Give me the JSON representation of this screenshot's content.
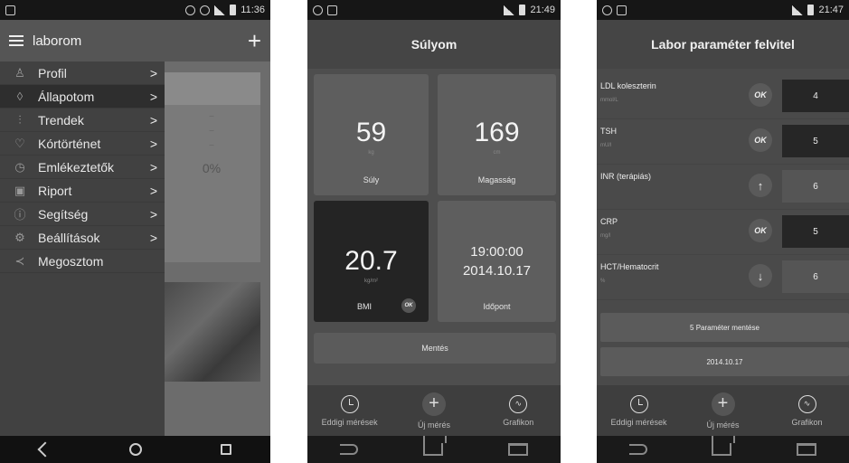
{
  "phone1": {
    "status": {
      "time": "11:36"
    },
    "appbar": {
      "title": "laborom",
      "add_glyph": "+"
    },
    "menu": [
      {
        "label": "Profil",
        "icon": "person-icon",
        "glyph": "♙",
        "chevron": ">"
      },
      {
        "label": "Állapotom",
        "icon": "drop-icon",
        "glyph": "◊",
        "chevron": ">"
      },
      {
        "label": "Trendek",
        "icon": "trend-icon",
        "glyph": "⫶",
        "chevron": ">"
      },
      {
        "label": "Kórtörténet",
        "icon": "stethoscope-icon",
        "glyph": "♡",
        "chevron": ">"
      },
      {
        "label": "Emlékeztetők",
        "icon": "alarm-icon",
        "glyph": "◷",
        "chevron": ">"
      },
      {
        "label": "Riport",
        "icon": "report-icon",
        "glyph": "▣",
        "chevron": ">"
      },
      {
        "label": "Segítség",
        "icon": "info-icon",
        "glyph": "ⓘ",
        "chevron": ">"
      },
      {
        "label": "Beállítások",
        "icon": "gear-icon",
        "glyph": "⚙",
        "chevron": ">"
      },
      {
        "label": "Megosztom",
        "icon": "share-icon",
        "glyph": "≺",
        "chevron": ""
      }
    ],
    "background": {
      "pct": "0%"
    }
  },
  "phone2": {
    "status": {
      "time": "21:49"
    },
    "title": "Súlyom",
    "tiles": {
      "weight": {
        "value": "59",
        "unit": "kg",
        "label": "Súly"
      },
      "height": {
        "value": "169",
        "unit": "cm",
        "label": "Magasság"
      },
      "bmi": {
        "value": "20.7",
        "unit": "kg/m²",
        "label": "BMI",
        "badge": "OK"
      },
      "time": {
        "clock": "19:00:00",
        "date": "2014.10.17",
        "label": "Időpont"
      }
    },
    "save_label": "Mentés",
    "tabs": [
      {
        "label": "Eddigi mérések",
        "icon": "clock-icon"
      },
      {
        "label": "Új mérés",
        "icon": "plus-icon"
      },
      {
        "label": "Grafikon",
        "icon": "graph-icon"
      }
    ]
  },
  "phone3": {
    "status": {
      "time": "21:47"
    },
    "title": "Labor paraméter felvitel",
    "params": [
      {
        "name": "LDL koleszterin",
        "unit": "mmol/L",
        "badge": "OK",
        "value": "4"
      },
      {
        "name": "TSH",
        "unit": "mU/l",
        "badge": "OK",
        "value": "5"
      },
      {
        "name": "INR (terápiás)",
        "unit": "",
        "badge": "↑",
        "value": "6"
      },
      {
        "name": "CRP",
        "unit": "mg/l",
        "badge": "OK",
        "value": "5"
      },
      {
        "name": "HCT/Hematocrit",
        "unit": "%",
        "badge": "↓",
        "value": "6"
      }
    ],
    "save_params_label": "5 Paraméter mentése",
    "date_label": "2014.10.17",
    "tabs": [
      {
        "label": "Eddigi mérések",
        "icon": "clock-icon"
      },
      {
        "label": "Új mérés",
        "icon": "plus-icon"
      },
      {
        "label": "Grafikon",
        "icon": "graph-icon"
      }
    ]
  }
}
